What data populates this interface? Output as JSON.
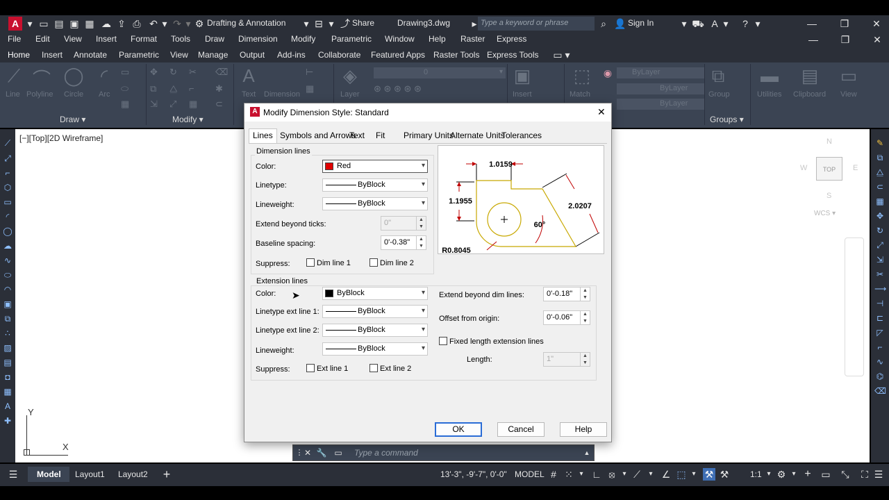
{
  "app": {
    "title": "Drawing3.dwg",
    "workspace": "Drafting & Annotation",
    "share_label": "Share",
    "search_placeholder": "Type a keyword or phrase",
    "signin_label": "Sign In",
    "logo_letter": "A"
  },
  "menubar": [
    "File",
    "Edit",
    "View",
    "Insert",
    "Format",
    "Tools",
    "Draw",
    "Dimension",
    "Modify",
    "Parametric",
    "Window",
    "Help",
    "Raster",
    "Express"
  ],
  "ribbon_tabs": [
    "Home",
    "Insert",
    "Annotate",
    "Parametric",
    "View",
    "Manage",
    "Output",
    "Add-ins",
    "Collaborate",
    "Featured Apps",
    "Raster Tools",
    "Express Tools"
  ],
  "ribbon": {
    "draw_tools": [
      "Line",
      "Polyline",
      "Circle",
      "Arc"
    ],
    "text_label": "Text",
    "dimension_label": "Dimension",
    "layer_label": "Layer",
    "layer_value": "0",
    "insert_label": "Insert",
    "match_label": "Match",
    "group_label": "Group",
    "utilities_label": "Utilities",
    "clipboard_label": "Clipboard",
    "view_label": "View",
    "bylayer_color": "ByLayer",
    "bylayer_linetype": "ByLayer",
    "bylayer_lineweight": "ByLayer",
    "panels": {
      "draw": "Draw",
      "modify": "Modify",
      "properties": "operties",
      "groups": "Groups"
    }
  },
  "viewport": {
    "label": "[−][Top][2D Wireframe]",
    "viewcube_top": "TOP",
    "compass_n": "N",
    "compass_s": "S",
    "compass_e": "E",
    "compass_w": "W",
    "wcs": "WCS",
    "ucs_x": "X",
    "ucs_y": "Y"
  },
  "command_line": {
    "placeholder": "Type a command"
  },
  "status": {
    "tabs": [
      "Model",
      "Layout1",
      "Layout2"
    ],
    "coords": "13'-3\", -9'-7\", 0'-0\"",
    "model_label": "MODEL",
    "scale": "1:1"
  },
  "dialog": {
    "title": "Modify Dimension Style: Standard",
    "tabs": [
      "Lines",
      "Symbols and Arrows",
      "Text",
      "Fit",
      "Primary Units",
      "Alternate Units",
      "Tolerances"
    ],
    "dimension_lines": {
      "group_label": "Dimension lines",
      "color_label": "Color:",
      "color_value": "Red",
      "color_swatch": "#e00000",
      "linetype_label": "Linetype:",
      "linetype_value": "ByBlock",
      "lineweight_label": "Lineweight:",
      "lineweight_value": "ByBlock",
      "extend_label": "Extend beyond ticks:",
      "extend_value": "0\"",
      "baseline_label": "Baseline spacing:",
      "baseline_value": "0'-0.38\"",
      "suppress_label": "Suppress:",
      "dim1_label": "Dim line 1",
      "dim2_label": "Dim line 2"
    },
    "extension_lines": {
      "group_label": "Extension lines",
      "color_label": "Color:",
      "color_value": "ByBlock",
      "color_swatch": "#000000",
      "lt1_label": "Linetype ext line 1:",
      "lt1_value": "ByBlock",
      "lt2_label": "Linetype ext line 2:",
      "lt2_value": "ByBlock",
      "lineweight_label": "Lineweight:",
      "lineweight_value": "ByBlock",
      "suppress_label": "Suppress:",
      "ext1_label": "Ext line 1",
      "ext2_label": "Ext line 2",
      "extend_label": "Extend beyond dim lines:",
      "extend_value": "0'-0.18\"",
      "offset_label": "Offset from origin:",
      "offset_value": "0'-0.06\"",
      "fixed_label": "Fixed length extension lines",
      "length_label": "Length:",
      "length_value": "1\""
    },
    "preview": {
      "dim_top": "1.0159",
      "dim_left": "1.1955",
      "dim_right": "2.0207",
      "angle": "60°",
      "radius": "R0.8045"
    },
    "buttons": {
      "ok": "OK",
      "cancel": "Cancel",
      "help": "Help"
    }
  }
}
